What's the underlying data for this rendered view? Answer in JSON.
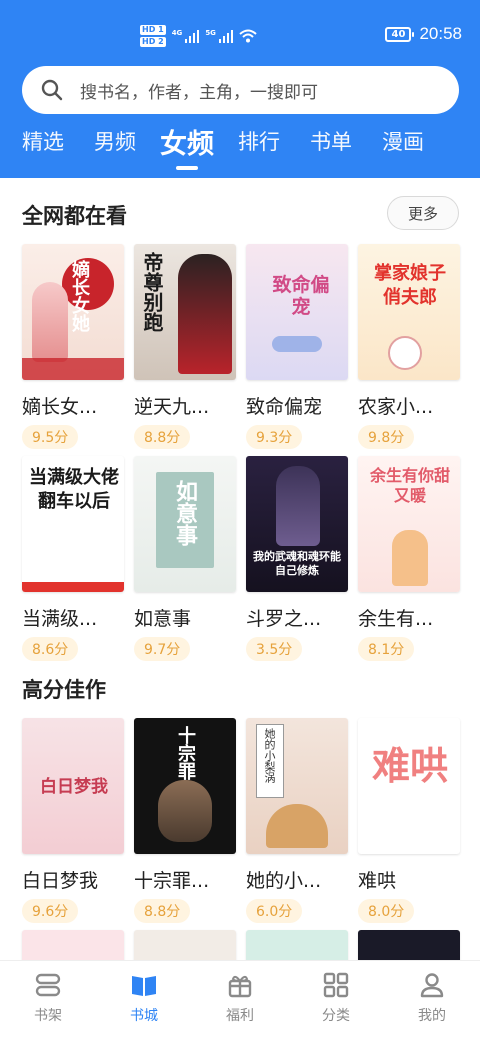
{
  "status_bar": {
    "hd1": "HD 1",
    "hd2": "HD 2",
    "sig1_label": "4G",
    "sig2_label": "5G",
    "battery": "40",
    "time": "20:58"
  },
  "search": {
    "placeholder": "搜书名，作者，主角，一搜即可"
  },
  "tabs": [
    {
      "label": "精选"
    },
    {
      "label": "男频"
    },
    {
      "label": "女频",
      "active": true
    },
    {
      "label": "排行"
    },
    {
      "label": "书单"
    },
    {
      "label": "漫画"
    }
  ],
  "sections": [
    {
      "title": "全网都在看",
      "more": "更多",
      "books": [
        {
          "title": "嫡长女...",
          "score": "9.5分",
          "cover_text": "嫡长女她"
        },
        {
          "title": "逆天九...",
          "score": "8.8分",
          "cover_text": "帝尊别跑"
        },
        {
          "title": "致命偏宠",
          "score": "9.3分",
          "cover_text": "致命偏宠"
        },
        {
          "title": "农家小...",
          "score": "9.8分",
          "cover_text": "掌家娘子俏夫郎"
        },
        {
          "title": "当满级...",
          "score": "8.6分",
          "cover_text": "当满级大佬翻车以后"
        },
        {
          "title": "如意事",
          "score": "9.7分",
          "cover_text": "如意事"
        },
        {
          "title": "斗罗之...",
          "score": "3.5分",
          "cover_text": "我的武魂和魂环能自己修炼"
        },
        {
          "title": "余生有...",
          "score": "8.1分",
          "cover_text": "余生有你甜又暖"
        }
      ]
    },
    {
      "title": "高分佳作",
      "books": [
        {
          "title": "白日梦我",
          "score": "9.6分",
          "cover_text": "白日梦我"
        },
        {
          "title": "十宗罪...",
          "score": "8.8分",
          "cover_text": "十宗罪"
        },
        {
          "title": "她的小...",
          "score": "6.0分",
          "cover_text": "她的小梨涡"
        },
        {
          "title": "难哄",
          "score": "8.0分",
          "cover_text": "难哄"
        }
      ]
    }
  ],
  "bottom_nav": [
    {
      "label": "书架",
      "icon": "bookshelf-icon"
    },
    {
      "label": "书城",
      "icon": "bookstore-icon",
      "active": true
    },
    {
      "label": "福利",
      "icon": "gift-icon"
    },
    {
      "label": "分类",
      "icon": "category-icon"
    },
    {
      "label": "我的",
      "icon": "user-icon"
    }
  ],
  "colors": {
    "accent": "#2f84f4",
    "score_text": "#e6a23c",
    "score_bg": "#fff4e0"
  }
}
